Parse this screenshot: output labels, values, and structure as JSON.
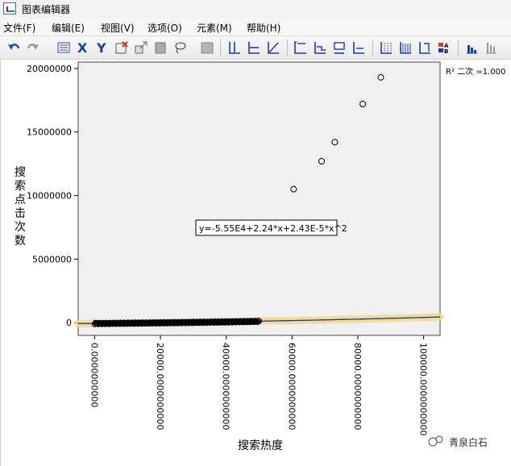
{
  "window": {
    "title": "图表编辑器"
  },
  "menu": [
    "文件(F)",
    "编辑(E)",
    "视图(V)",
    "选项(O)",
    "元素(M)",
    "帮助(H)"
  ],
  "toolbar": {
    "icons": [
      "undo-icon",
      "redo-icon",
      "properties-icon",
      "x-axis-icon",
      "y-axis-icon",
      "select-x-icon",
      "scale-icon",
      "bar-icon",
      "lasso-icon",
      "gray-icon",
      "ref-line-y-icon",
      "ref-line-x-icon",
      "ref-line-diag-icon",
      "fit-line-icon",
      "interp-line-icon",
      "annotation-icon",
      "textbox-icon",
      "grid-icon",
      "bar-table-icon",
      "bracket-icon",
      "legend-ab-icon",
      "histogram-icon",
      "column-icon"
    ]
  },
  "chart_data": {
    "type": "scatter",
    "xlabel": "搜索热度",
    "ylabel": "搜索点击次数",
    "xlim": [
      -5000,
      105000
    ],
    "ylim": [
      -1000000,
      20500000
    ],
    "x_ticks": [
      {
        "v": 0,
        "label": "0.0000000000"
      },
      {
        "v": 20000,
        "label": "20000.0000000000"
      },
      {
        "v": 40000,
        "label": "40000.0000000000"
      },
      {
        "v": 60000,
        "label": "60000.0000000000"
      },
      {
        "v": 80000,
        "label": "80000.0000000000"
      },
      {
        "v": 100000,
        "label": "100000.0000000000"
      }
    ],
    "y_ticks": [
      {
        "v": 0,
        "label": "0"
      },
      {
        "v": 5000000,
        "label": "5000000"
      },
      {
        "v": 10000000,
        "label": "10000000"
      },
      {
        "v": 15000000,
        "label": "15000000"
      },
      {
        "v": 20000000,
        "label": "20000000"
      }
    ],
    "points": [
      [
        60500,
        10500000
      ],
      [
        69000,
        12700000
      ],
      [
        73000,
        14200000
      ],
      [
        81500,
        17200000
      ],
      [
        87000,
        19300000
      ]
    ],
    "dense_range": [
      0,
      50000
    ],
    "fit": {
      "a": -55500,
      "b": 2.24,
      "c": 2.43e-05,
      "label": "y=-5.55E4+2.24*x+2.43E-5*x^2"
    },
    "r2_label": "R² 二次 =1.000",
    "grid": false,
    "background": "#f0f0f0",
    "line_color": "#1f3a8a",
    "band_color": "#f5d78a"
  },
  "watermark": {
    "text": "青泉白石"
  }
}
